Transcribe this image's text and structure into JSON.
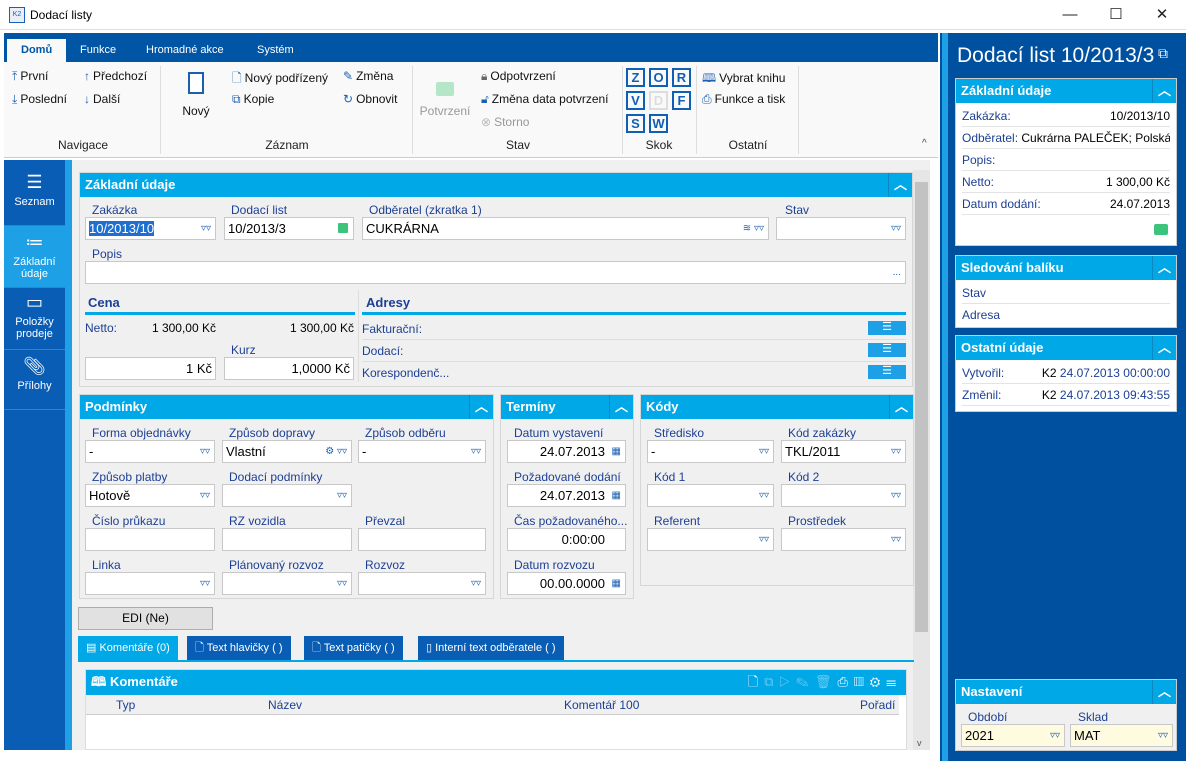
{
  "window": {
    "title": "Dodací listy",
    "minimize": "—",
    "maximize": "☐",
    "close": "✕"
  },
  "ribbon": {
    "tabs": [
      "Domů",
      "Funkce",
      "Hromadné akce",
      "Systém"
    ],
    "navigace": {
      "first": "První",
      "prev": "Předchozí",
      "last": "Poslední",
      "next": "Další",
      "group": "Navigace"
    },
    "zaznam": {
      "new": "Nový",
      "new_child": "Nový podřízený",
      "copy": "Kopie",
      "edit": "Změna",
      "refresh": "Obnovit",
      "group": "Záznam"
    },
    "stav": {
      "confirm": "Potvrzení",
      "unconfirm": "Odpotvrzení",
      "change_date": "Změna data potvrzení",
      "storno": "Storno",
      "group": "Stav"
    },
    "skok": {
      "keys": [
        "Z",
        "O",
        "R",
        "V",
        "D",
        "F",
        "S",
        "W"
      ],
      "group": "Skok"
    },
    "ostatni": {
      "book": "Vybrat knihu",
      "print": "Funkce a tisk",
      "group": "Ostatní"
    }
  },
  "leftnav": [
    {
      "label": "Seznam",
      "icon": "menu-icon"
    },
    {
      "label": "Základní údaje",
      "icon": "list-icon"
    },
    {
      "label": "Položky prodeje",
      "icon": "box-icon"
    },
    {
      "label": "Přílohy",
      "icon": "paperclip-icon"
    }
  ],
  "zakladni": {
    "title": "Základní údaje",
    "zakazka": {
      "label": "Zakázka",
      "value": "10/2013/10"
    },
    "dodaci_list": {
      "label": "Dodací list",
      "value": "10/2013/3"
    },
    "odberatel": {
      "label": "Odběratel (zkratka 1)",
      "value": "CUKRÁRNA"
    },
    "stav": {
      "label": "Stav",
      "value": ""
    },
    "popis": {
      "label": "Popis",
      "value": "",
      "more": "..."
    },
    "cena": {
      "title": "Cena",
      "netto_label": "Netto:",
      "netto1": "1 300,00 Kč",
      "netto2": "1 300,00 Kč",
      "kurz_label": "Kurz",
      "amount": "1 Kč",
      "kurz": "1,0000 Kč"
    },
    "adresy": {
      "title": "Adresy",
      "rows": [
        "Fakturační:",
        "Dodací:",
        "Korespondenč..."
      ]
    }
  },
  "podminky": {
    "title": "Podmínky",
    "fields": [
      {
        "label": "Forma objednávky",
        "value": "-"
      },
      {
        "label": "Způsob dopravy",
        "value": "Vlastní"
      },
      {
        "label": "Způsob odběru",
        "value": "-"
      },
      {
        "label": "Způsob platby",
        "value": "Hotově"
      },
      {
        "label": "Dodací podmínky",
        "value": ""
      },
      {
        "label": "Číslo průkazu",
        "value": ""
      },
      {
        "label": "RZ vozidla",
        "value": ""
      },
      {
        "label": "Převzal",
        "value": ""
      },
      {
        "label": "Linka",
        "value": ""
      },
      {
        "label": "Plánovaný rozvoz",
        "value": ""
      },
      {
        "label": "Rozvoz",
        "value": ""
      }
    ]
  },
  "terminy": {
    "title": "Termíny",
    "fields": [
      {
        "label": "Datum vystavení",
        "value": "24.07.2013"
      },
      {
        "label": "Požadované dodání",
        "value": "24.07.2013"
      },
      {
        "label": "Čas požadovaného...",
        "value": "0:00:00"
      },
      {
        "label": "Datum rozvozu",
        "value": "00.00.0000"
      }
    ]
  },
  "kody": {
    "title": "Kódy",
    "fields": [
      {
        "label": "Středisko",
        "value": "-"
      },
      {
        "label": "Kód zakázky",
        "value": "TKL/2011"
      },
      {
        "label": "Kód 1",
        "value": ""
      },
      {
        "label": "Kód 2",
        "value": ""
      },
      {
        "label": "Referent",
        "value": ""
      },
      {
        "label": "Prostředek",
        "value": ""
      }
    ]
  },
  "edi": "EDI (Ne)",
  "tabs": [
    "Komentáře (0)",
    "Text hlavičky ( )",
    "Text patičky ( )",
    "Interní text odběratele ( )"
  ],
  "komentare": {
    "title": "Komentáře",
    "columns": [
      "Typ",
      "Název",
      "Komentář 100",
      "Pořadí"
    ]
  },
  "right": {
    "title": "Dodací list 10/2013/3",
    "zakladni": {
      "title": "Základní údaje",
      "rows": [
        {
          "label": "Zakázka:",
          "value": "10/2013/10"
        },
        {
          "label": "Odběratel:",
          "value": "Cukrárna PALEČEK; Polská; ..."
        },
        {
          "label": "Popis:",
          "value": ""
        },
        {
          "label": "Netto:",
          "value": "1 300,00 Kč"
        },
        {
          "label": "Datum dodání:",
          "value": "24.07.2013"
        }
      ]
    },
    "baliky": {
      "title": "Sledování balíku",
      "rows": [
        "Stav",
        "Adresa"
      ]
    },
    "ostatni": {
      "title": "Ostatní údaje",
      "rows": [
        {
          "label": "Vytvořil:",
          "user": "K2",
          "value": "24.07.2013 00:00:00"
        },
        {
          "label": "Změnil:",
          "user": "K2",
          "value": "24.07.2013 09:43:55"
        }
      ]
    },
    "nastaveni": {
      "title": "Nastavení",
      "obdobi_label": "Období",
      "obdobi": "2021",
      "sklad_label": "Sklad",
      "sklad": "MAT"
    }
  },
  "colors": {
    "dark_blue": "#0055a5",
    "cyan": "#00a8e8",
    "lock_green": "#3cc47c"
  }
}
